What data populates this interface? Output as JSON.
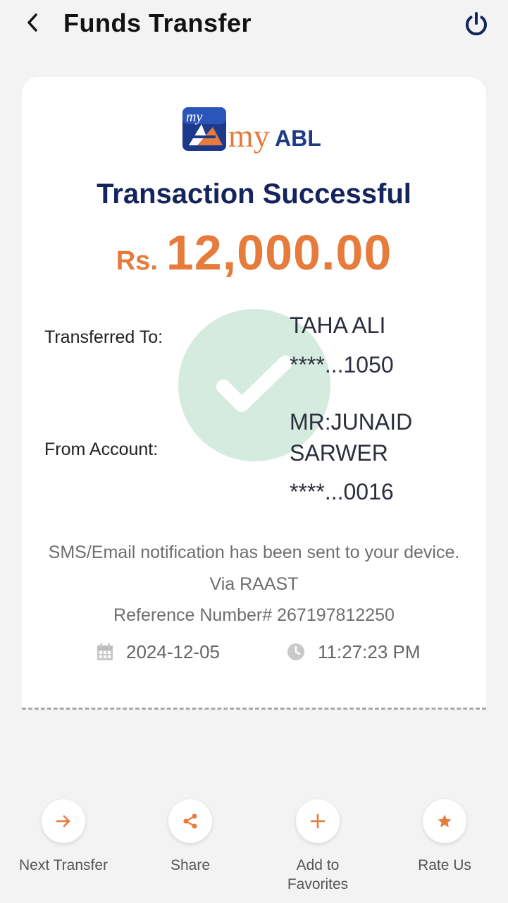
{
  "header": {
    "title": "Funds Transfer",
    "back_icon": "chevron-left-icon",
    "power_icon": "power-icon"
  },
  "logo": {
    "badge_text": "my",
    "word_my": "my",
    "word_abl": "ABL"
  },
  "receipt": {
    "status": "Transaction Successful",
    "currency": "Rs.",
    "amount": "12,000.00",
    "transferred_to_label": "Transferred To:",
    "transferred_to_name": "TAHA ALI",
    "transferred_to_account": "****...1050",
    "from_account_label": "From Account:",
    "from_name_line1": "MR:JUNAID",
    "from_name_line2": "SARWER",
    "from_account": "****...0016",
    "notification": "SMS/Email notification has been sent to your device.",
    "via": "Via RAAST",
    "reference": "Reference Number# 267197812250",
    "date": "2024-12-05",
    "time": "11:27:23 PM"
  },
  "actions": [
    {
      "label": "Next Transfer",
      "icon": "arrow-right-icon"
    },
    {
      "label": "Share",
      "icon": "share-icon"
    },
    {
      "label_line1": "Add to",
      "label_line2": "Favorites",
      "icon": "plus-icon"
    },
    {
      "label": "Rate Us",
      "icon": "star-icon"
    }
  ],
  "colors": {
    "accent": "#e67b3c",
    "navy": "#14245c",
    "success": "#78be96"
  }
}
